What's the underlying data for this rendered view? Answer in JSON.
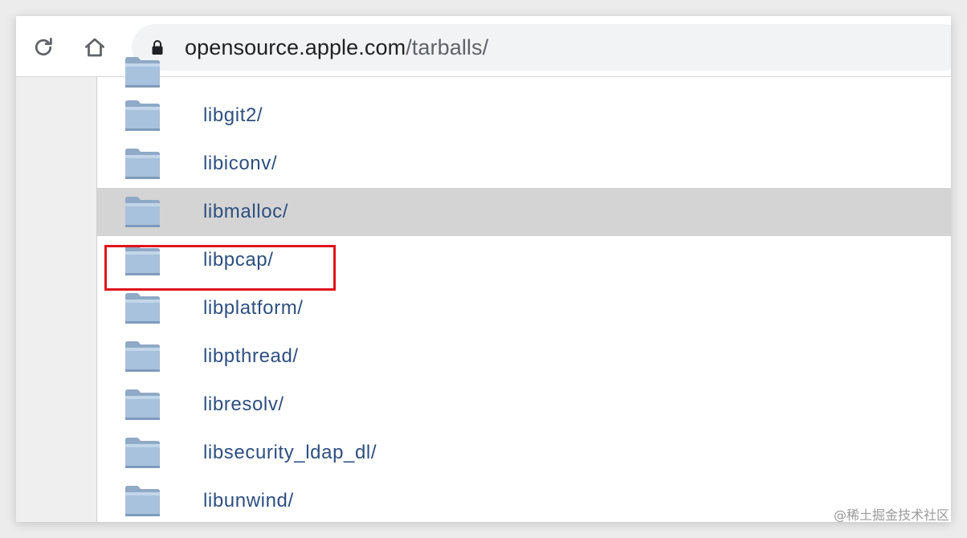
{
  "browser": {
    "url_host": "opensource.apple.com",
    "url_path": "/tarballs/",
    "reload_icon": "reload-icon",
    "home_icon": "home-icon",
    "lock_icon": "lock-icon"
  },
  "listing": {
    "folder_icon": "folder-icon",
    "selected_index": 2,
    "highlighted_item": "libmalloc/",
    "items": [
      {
        "label": "libgit2/"
      },
      {
        "label": "libiconv/"
      },
      {
        "label": "libmalloc/"
      },
      {
        "label": "libpcap/"
      },
      {
        "label": "libplatform/"
      },
      {
        "label": "libpthread/"
      },
      {
        "label": "libresolv/"
      },
      {
        "label": "libsecurity_ldap_dl/"
      },
      {
        "label": "libunwind/"
      }
    ]
  },
  "colors": {
    "link": "#2d4f80",
    "selected_row": "#d4d4d4",
    "highlight_border": "#e0141c",
    "omnibox_bg": "#f1f3f4"
  },
  "watermark": "@稀土掘金技术社区"
}
